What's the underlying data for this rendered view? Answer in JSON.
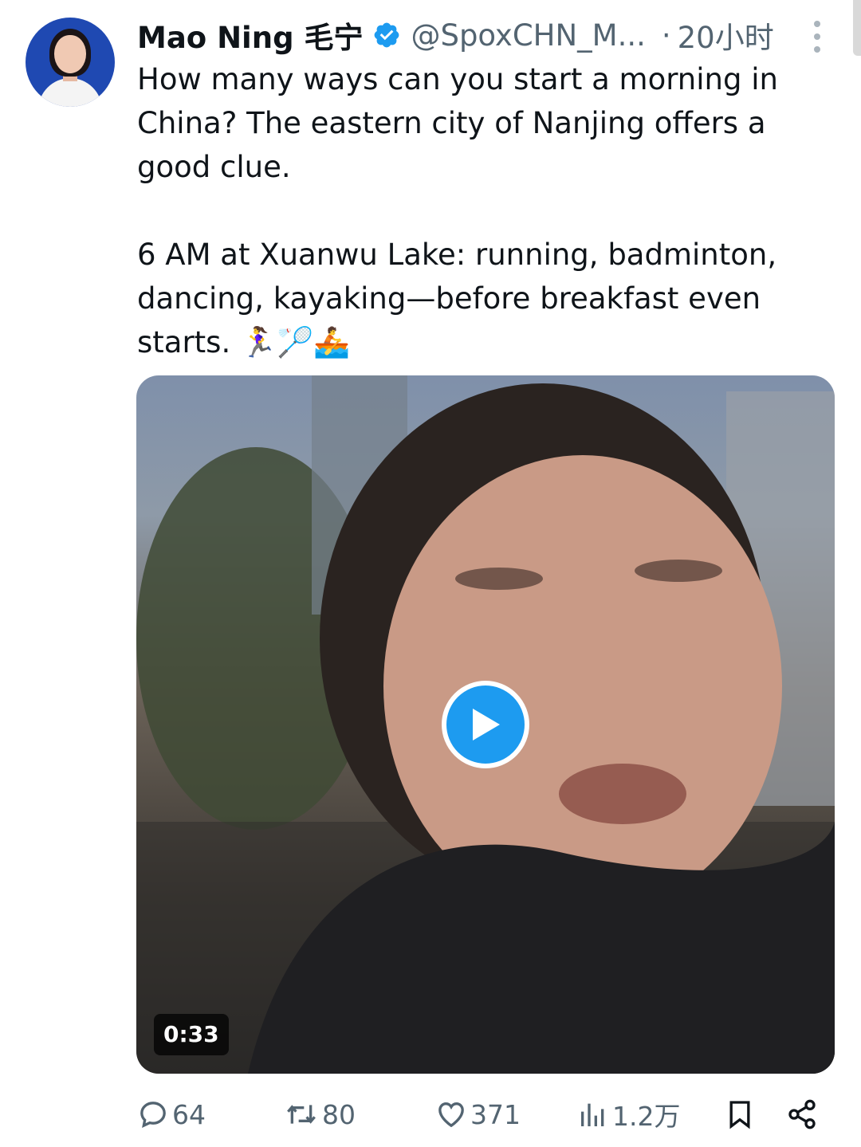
{
  "author": {
    "name": "Mao Ning 毛宁",
    "handle": "@SpoxCHN_M...",
    "time_separator": "·",
    "time": "20小时",
    "verified_color": "#1d9bf0"
  },
  "tweet": {
    "paragraph1": "How many ways can you start a morning in China? The eastern city of Nanjing offers a good clue.",
    "paragraph2": "6 AM at Xuanwu Lake: running, badminton, dancing, kayaking—before breakfast even starts.",
    "emojis": "🏃‍♀️🏸🚣"
  },
  "media": {
    "type": "video",
    "duration": "0:33",
    "play_color": "#1d9bf0"
  },
  "actions": {
    "replies": "64",
    "reposts": "80",
    "likes": "371",
    "views": "1.2万"
  },
  "icons": [
    "verified-badge-icon",
    "more-options-icon",
    "play-icon",
    "reply-icon",
    "repost-icon",
    "like-icon",
    "views-icon",
    "bookmark-icon",
    "share-icon"
  ]
}
